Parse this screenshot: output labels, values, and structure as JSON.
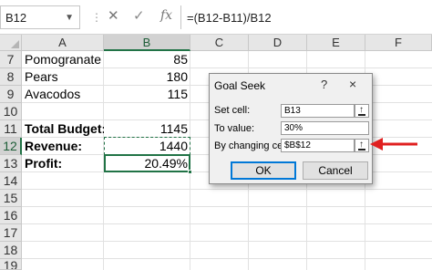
{
  "formula_bar": {
    "name_box": "B12",
    "formula": "=(B12-B11)/B12"
  },
  "columns": [
    "A",
    "B",
    "C",
    "D",
    "E",
    "F"
  ],
  "rows": [
    {
      "num": "7",
      "a": "Pomogranate",
      "b": "85",
      "bold": false
    },
    {
      "num": "8",
      "a": "Pears",
      "b": "180",
      "bold": false
    },
    {
      "num": "9",
      "a": "Avacodos",
      "b": "115",
      "bold": false
    },
    {
      "num": "10",
      "a": "",
      "b": "",
      "bold": false
    },
    {
      "num": "11",
      "a": "Total Budget:",
      "b": "1145",
      "bold": true
    },
    {
      "num": "12",
      "a": "Revenue:",
      "b": "1440",
      "bold": true
    },
    {
      "num": "13",
      "a": "Profit:",
      "b": "20.49%",
      "bold": true
    },
    {
      "num": "14",
      "a": "",
      "b": "",
      "bold": false
    },
    {
      "num": "15",
      "a": "",
      "b": "",
      "bold": false
    },
    {
      "num": "16",
      "a": "",
      "b": "",
      "bold": false
    },
    {
      "num": "17",
      "a": "",
      "b": "",
      "bold": false
    },
    {
      "num": "18",
      "a": "",
      "b": "",
      "bold": false
    },
    {
      "num": "19",
      "a": "",
      "b": "",
      "bold": false
    }
  ],
  "dialog": {
    "title": "Goal Seek",
    "help": "?",
    "close": "×",
    "set_cell_label": "Set cell:",
    "set_cell_value": "B13",
    "to_value_label": "To value:",
    "to_value_value": "30%",
    "changing_cell_label": "By changing cell:",
    "changing_cell_value": "$B$12",
    "ok_label": "OK",
    "cancel_label": "Cancel"
  },
  "colors": {
    "selection": "#217346",
    "arrow": "#e02020"
  }
}
